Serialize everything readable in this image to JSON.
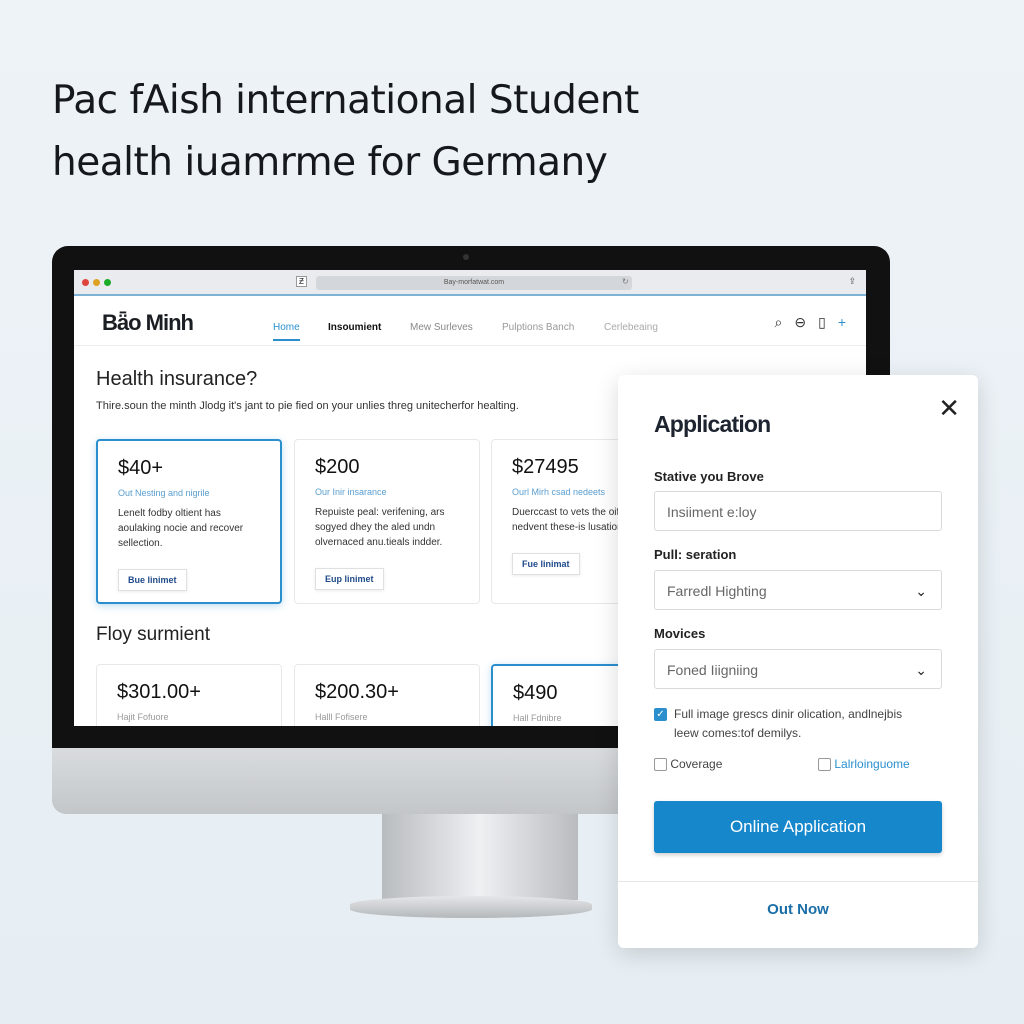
{
  "headline": {
    "line1": "Pac fAish international Student",
    "line2": "health iuamrme for Germany"
  },
  "browser": {
    "url": "Bay-morfatwat.com"
  },
  "site": {
    "logo": "Bǟo Minh",
    "nav": [
      "Home",
      "Insoumient",
      "Mew Surleves",
      "Pulptions Banch",
      "Cerlebeaing"
    ],
    "active_nav": "Home"
  },
  "section1": {
    "title": "Health insurance?",
    "subtitle": "Thire.soun the minth Jlodg it's jant to pie fied on your unlies threg unitecherfor healting.",
    "cards": [
      {
        "price": "$40+",
        "tag": "Out Nesting and nigrile",
        "desc": "Lenelt fodby oltient has aoulaking nocie and recover sellection.",
        "button": "Bue linimet",
        "selected": true
      },
      {
        "price": "$200",
        "tag": "Our Inir insarance",
        "desc": "Repuiste peal: verifening, ars sogyed dhey the aled undn olvernaced anu.tieals indder.",
        "button": "Eup linimet",
        "selected": false
      },
      {
        "price": "$27495",
        "tag": "Ourl Mirh csad nedeets",
        "desc": "Duerccast to vets the oifir nedvent these-is lusation.",
        "button": "Fue linimat",
        "selected": false
      }
    ]
  },
  "section2": {
    "title": "Floy surmient",
    "cards": [
      {
        "price": "$301.00+",
        "tag": "Hajit Fofuore",
        "selected": false
      },
      {
        "price": "$200.30+",
        "tag": "Halll Fofisere",
        "selected": false
      },
      {
        "price": "$490",
        "tag": "Hall Fdnibre",
        "selected": true
      }
    ]
  },
  "modal": {
    "title": "Application",
    "field1_label": "Stative you Brove",
    "field1_value": "Insiiment e:loy",
    "field2_label": "Pull: seration",
    "field2_value": "Farredl Highting",
    "field3_label": "Movices",
    "field3_value": "Foned Iiigniing",
    "consent": "Full image grescs dinir olication, andlnejbis leew comes:tof demilys.",
    "consent_checked": true,
    "opt1": "Coverage",
    "opt2": "Lalrloinguome",
    "primary": "Online Application",
    "secondary": "Out Now"
  },
  "colors": {
    "accent": "#1787cc"
  }
}
